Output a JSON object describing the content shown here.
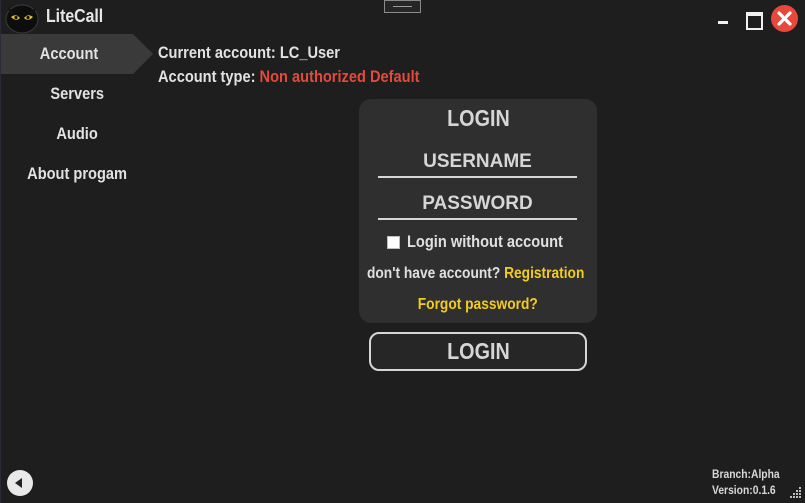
{
  "app": {
    "title": "LiteCall",
    "logo_icon": "owl-logo-icon"
  },
  "sidebar": {
    "items": [
      {
        "label": "Account",
        "active": true
      },
      {
        "label": "Servers",
        "active": false
      },
      {
        "label": "Audio",
        "active": false
      },
      {
        "label": "About progam",
        "active": false
      }
    ]
  },
  "account": {
    "current_label": "Current account: ",
    "current_value": "LC_User",
    "type_label": "Account type: ",
    "type_value": "Non authorized Default"
  },
  "login_panel": {
    "title": "LOGIN",
    "username_placeholder": "USERNAME",
    "password_placeholder": "PASSWORD",
    "checkbox_label": "Login without account",
    "checkbox_checked": false,
    "no_account_text": "don't have account?",
    "registration_link": "Registration",
    "forgot_link": "Forgot password?"
  },
  "login_button": "LOGIN",
  "footer": {
    "branch": "Branch:Alpha",
    "version": "Version:0.1.6"
  },
  "colors": {
    "accent_red": "#e24a3b",
    "link_yellow": "#f2cc1e",
    "close_red": "#e8483c"
  }
}
